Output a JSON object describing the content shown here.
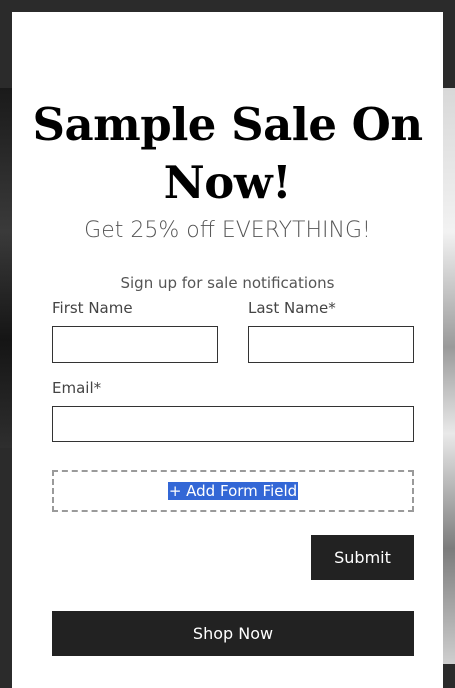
{
  "popup": {
    "title": "Sample Sale On Now!",
    "subtitle": "Get 25% off EVERYTHING!",
    "tagline": "Sign up for sale notifications"
  },
  "form": {
    "first_name_label": "First Name",
    "last_name_label": "Last Name*",
    "email_label": "Email*",
    "first_name_value": "",
    "last_name_value": "",
    "email_value": "",
    "add_field_label": "+ Add Form Field",
    "submit_label": "Submit"
  },
  "cta": {
    "shop_now_label": "Shop Now"
  },
  "colors": {
    "button_bg": "#222222",
    "selection_highlight": "#3367d6"
  }
}
